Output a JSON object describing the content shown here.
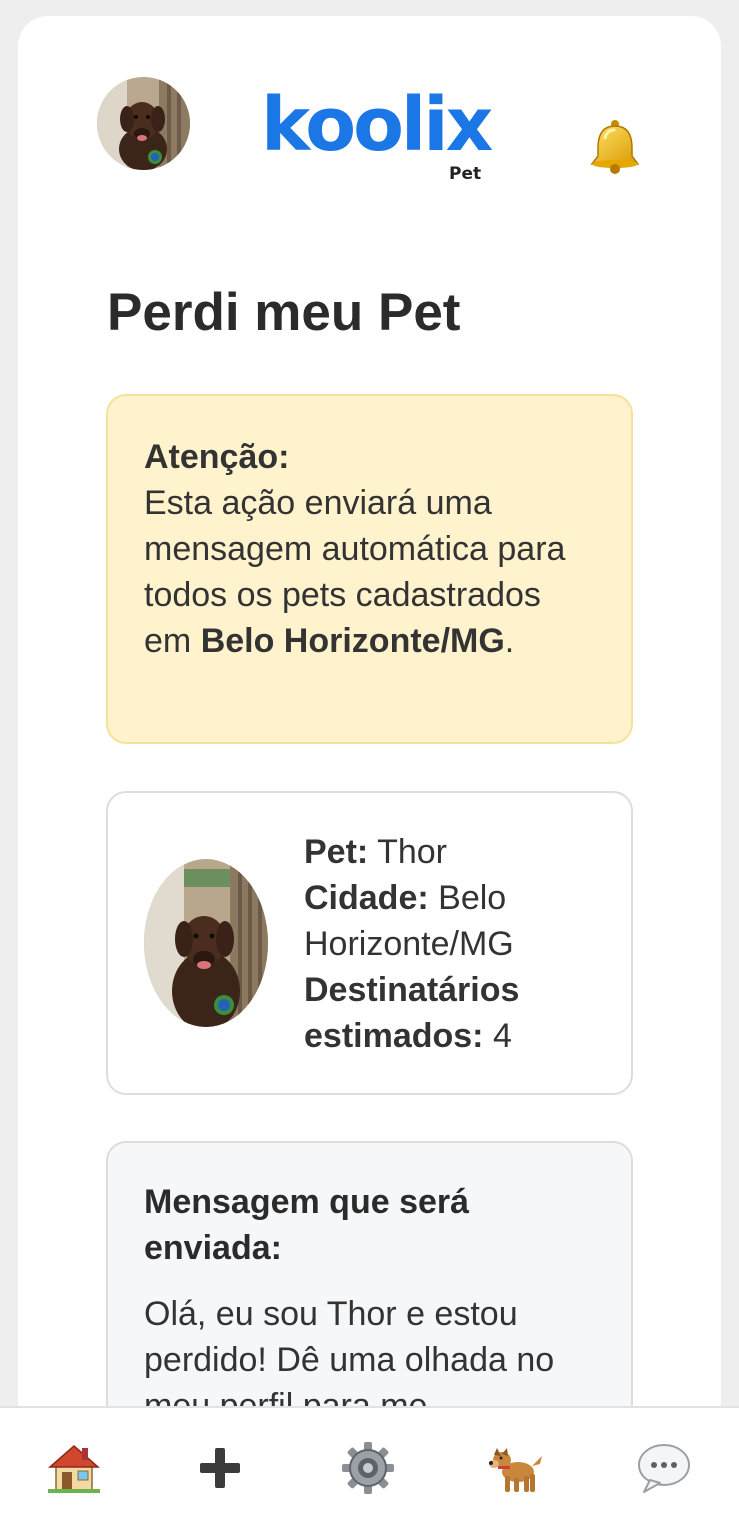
{
  "header": {
    "logo_text": "koolix",
    "logo_sub": "Pet",
    "avatar_icon": "dog-avatar-photo",
    "notification_icon": "bell-icon"
  },
  "page": {
    "title": "Perdi meu Pet"
  },
  "alert": {
    "label": "Atenção:",
    "text_1": "Esta ação enviará uma mensagem automática para todos os pets cadastrados em ",
    "city": "Belo Horizonte/MG",
    "text_2": ".",
    "background": "#fff3cd"
  },
  "pet": {
    "name_label": "Pet:",
    "name": "Thor",
    "city_label": "Cidade:",
    "city": "Belo Horizonte/MG",
    "recipients_label": "Destinatários estimados:",
    "recipients": "4"
  },
  "message": {
    "title": "Mensagem que será enviada:",
    "body": "Olá, eu sou Thor e estou perdido! Dê uma olhada no meu perfil para me"
  },
  "bottom_nav": {
    "items": [
      {
        "name": "home",
        "icon": "house-icon"
      },
      {
        "name": "add",
        "icon": "plus-icon"
      },
      {
        "name": "settings",
        "icon": "gear-icon"
      },
      {
        "name": "pets",
        "icon": "dog-icon"
      },
      {
        "name": "chat",
        "icon": "speech-bubble-icon"
      }
    ]
  },
  "colors": {
    "brand": "#1b76e6",
    "text": "#2b2b2b",
    "card_border": "#dddddd"
  }
}
